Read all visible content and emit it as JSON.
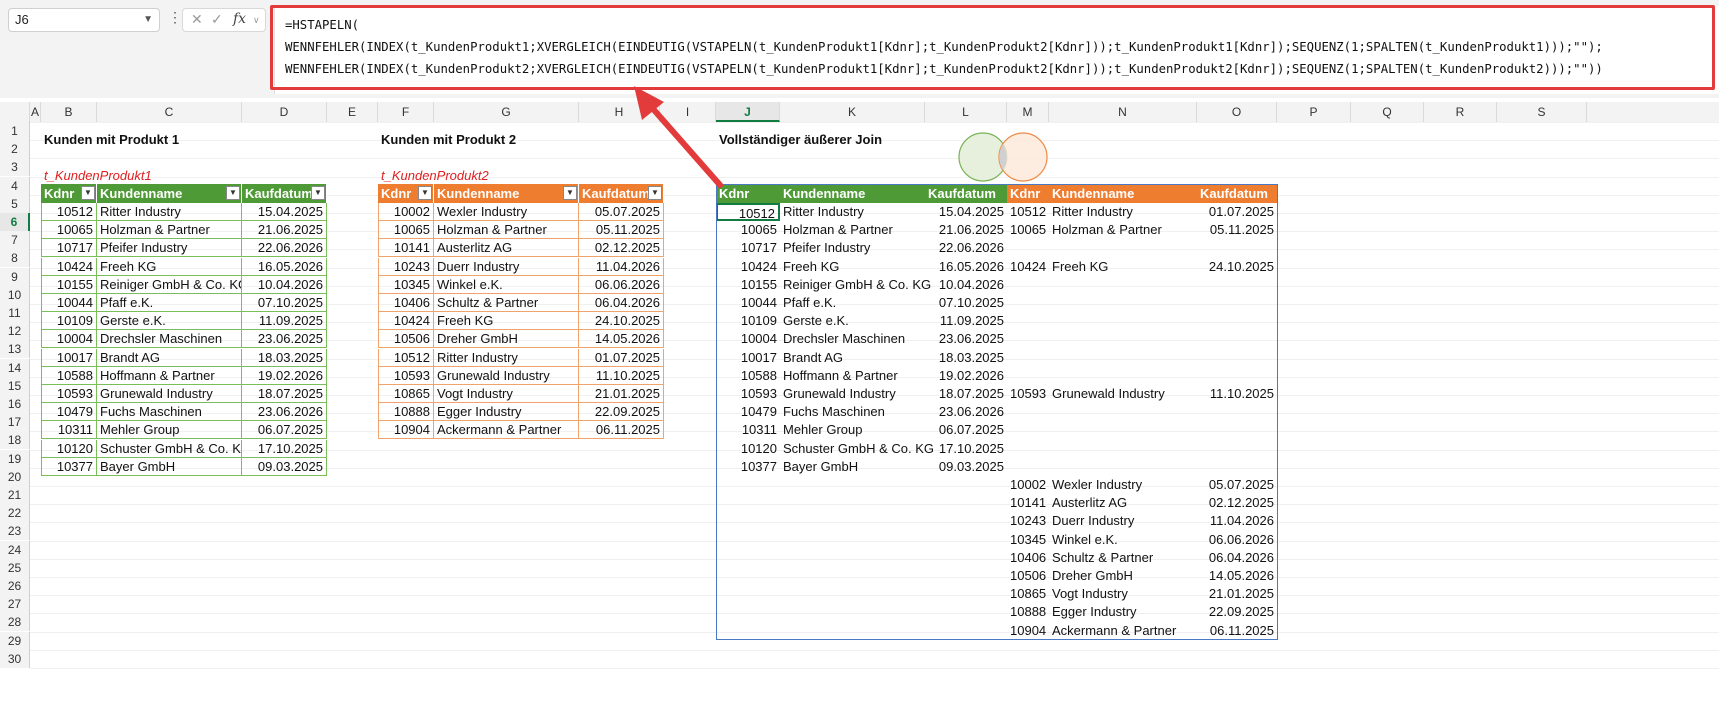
{
  "name_box": "J6",
  "formula_lines": [
    "=HSTAPELN(",
    "WENNFEHLER(INDEX(t_KundenProdukt1;XVERGLEICH(EINDEUTIG(VSTAPELN(t_KundenProdukt1[Kdnr];t_KundenProdukt2[Kdnr]));t_KundenProdukt1[Kdnr]);SEQUENZ(1;SPALTEN(t_KundenProdukt1)));\"\");",
    "WENNFEHLER(INDEX(t_KundenProdukt2;XVERGLEICH(EINDEUTIG(VSTAPELN(t_KundenProdukt1[Kdnr];t_KundenProdukt2[Kdnr]));t_KundenProdukt2[Kdnr]);SEQUENZ(1;SPALTEN(t_KundenProdukt2)));\"\"))"
  ],
  "columns": [
    "A",
    "B",
    "C",
    "D",
    "E",
    "F",
    "G",
    "H",
    "I",
    "J",
    "K",
    "L",
    "M",
    "N",
    "O",
    "P",
    "Q",
    "R",
    "S"
  ],
  "selected_column": "J",
  "rows": [
    "1",
    "2",
    "3",
    "4",
    "5",
    "6",
    "7",
    "8",
    "9",
    "10",
    "11",
    "12",
    "13",
    "14",
    "15",
    "16",
    "17",
    "18",
    "19",
    "20",
    "21",
    "22",
    "23",
    "24",
    "25",
    "26",
    "27",
    "28",
    "29",
    "30"
  ],
  "selected_row": "6",
  "section1": {
    "title": "Kunden mit Produkt 1",
    "table_name": "t_KundenProdukt1"
  },
  "section2": {
    "title": "Kunden mit Produkt 2",
    "table_name": "t_KundenProdukt2"
  },
  "section3": {
    "title": "Vollständiger äußerer Join"
  },
  "headers": {
    "kdnr": "Kdnr",
    "name": "Kundenname",
    "date": "Kaufdatum"
  },
  "colors": {
    "green_header": "#4e9a36",
    "orange_header": "#ef7d2f",
    "highlight": "#e33b3b",
    "selected": "#107c41"
  },
  "table1": [
    [
      "10512",
      "Ritter Industry",
      "15.04.2025"
    ],
    [
      "10065",
      "Holzman & Partner",
      "21.06.2025"
    ],
    [
      "10717",
      "Pfeifer Industry",
      "22.06.2026"
    ],
    [
      "10424",
      "Freeh KG",
      "16.05.2026"
    ],
    [
      "10155",
      "Reiniger GmbH & Co. KG",
      "10.04.2026"
    ],
    [
      "10044",
      "Pfaff e.K.",
      "07.10.2025"
    ],
    [
      "10109",
      "Gerste e.K.",
      "11.09.2025"
    ],
    [
      "10004",
      "Drechsler Maschinen",
      "23.06.2025"
    ],
    [
      "10017",
      "Brandt AG",
      "18.03.2025"
    ],
    [
      "10588",
      "Hoffmann & Partner",
      "19.02.2026"
    ],
    [
      "10593",
      "Grunewald Industry",
      "18.07.2025"
    ],
    [
      "10479",
      "Fuchs Maschinen",
      "23.06.2026"
    ],
    [
      "10311",
      "Mehler Group",
      "06.07.2025"
    ],
    [
      "10120",
      "Schuster GmbH & Co. KG",
      "17.10.2025"
    ],
    [
      "10377",
      "Bayer GmbH",
      "09.03.2025"
    ]
  ],
  "table2": [
    [
      "10002",
      "Wexler Industry",
      "05.07.2025"
    ],
    [
      "10065",
      "Holzman & Partner",
      "05.11.2025"
    ],
    [
      "10141",
      "Austerlitz AG",
      "02.12.2025"
    ],
    [
      "10243",
      "Duerr Industry",
      "11.04.2026"
    ],
    [
      "10345",
      "Winkel e.K.",
      "06.06.2026"
    ],
    [
      "10406",
      "Schultz & Partner",
      "06.04.2026"
    ],
    [
      "10424",
      "Freeh KG",
      "24.10.2025"
    ],
    [
      "10506",
      "Dreher GmbH",
      "14.05.2026"
    ],
    [
      "10512",
      "Ritter Industry",
      "01.07.2025"
    ],
    [
      "10593",
      "Grunewald Industry",
      "11.10.2025"
    ],
    [
      "10865",
      "Vogt Industry",
      "21.01.2025"
    ],
    [
      "10888",
      "Egger Industry",
      "22.09.2025"
    ],
    [
      "10904",
      "Ackermann & Partner",
      "06.11.2025"
    ]
  ],
  "join": [
    [
      "10512",
      "Ritter Industry",
      "15.04.2025",
      "10512",
      "Ritter Industry",
      "01.07.2025"
    ],
    [
      "10065",
      "Holzman & Partner",
      "21.06.2025",
      "10065",
      "Holzman & Partner",
      "05.11.2025"
    ],
    [
      "10717",
      "Pfeifer Industry",
      "22.06.2026",
      "",
      "",
      ""
    ],
    [
      "10424",
      "Freeh KG",
      "16.05.2026",
      "10424",
      "Freeh KG",
      "24.10.2025"
    ],
    [
      "10155",
      "Reiniger GmbH & Co. KG",
      "10.04.2026",
      "",
      "",
      ""
    ],
    [
      "10044",
      "Pfaff e.K.",
      "07.10.2025",
      "",
      "",
      ""
    ],
    [
      "10109",
      "Gerste e.K.",
      "11.09.2025",
      "",
      "",
      ""
    ],
    [
      "10004",
      "Drechsler Maschinen",
      "23.06.2025",
      "",
      "",
      ""
    ],
    [
      "10017",
      "Brandt AG",
      "18.03.2025",
      "",
      "",
      ""
    ],
    [
      "10588",
      "Hoffmann & Partner",
      "19.02.2026",
      "",
      "",
      ""
    ],
    [
      "10593",
      "Grunewald Industry",
      "18.07.2025",
      "10593",
      "Grunewald Industry",
      "11.10.2025"
    ],
    [
      "10479",
      "Fuchs Maschinen",
      "23.06.2026",
      "",
      "",
      ""
    ],
    [
      "10311",
      "Mehler Group",
      "06.07.2025",
      "",
      "",
      ""
    ],
    [
      "10120",
      "Schuster GmbH & Co. KG",
      "17.10.2025",
      "",
      "",
      ""
    ],
    [
      "10377",
      "Bayer GmbH",
      "09.03.2025",
      "",
      "",
      ""
    ],
    [
      "",
      "",
      "",
      "10002",
      "Wexler Industry",
      "05.07.2025"
    ],
    [
      "",
      "",
      "",
      "10141",
      "Austerlitz AG",
      "02.12.2025"
    ],
    [
      "",
      "",
      "",
      "10243",
      "Duerr Industry",
      "11.04.2026"
    ],
    [
      "",
      "",
      "",
      "10345",
      "Winkel e.K.",
      "06.06.2026"
    ],
    [
      "",
      "",
      "",
      "10406",
      "Schultz & Partner",
      "06.04.2026"
    ],
    [
      "",
      "",
      "",
      "10506",
      "Dreher GmbH",
      "14.05.2026"
    ],
    [
      "",
      "",
      "",
      "10865",
      "Vogt Industry",
      "21.01.2025"
    ],
    [
      "",
      "",
      "",
      "10888",
      "Egger Industry",
      "22.09.2025"
    ],
    [
      "",
      "",
      "",
      "10904",
      "Ackermann & Partner",
      "06.11.2025"
    ]
  ]
}
